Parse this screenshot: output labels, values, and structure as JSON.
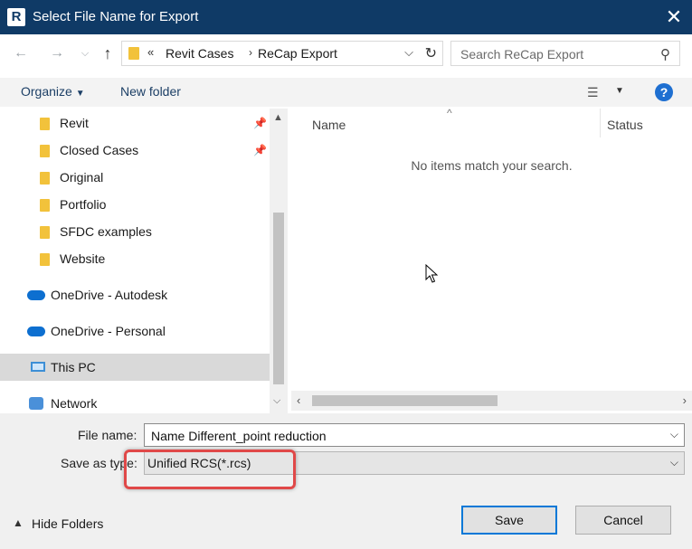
{
  "window": {
    "title": "Select File Name for Export",
    "app_icon_letter": "R"
  },
  "address_bar": {
    "overflow": "«",
    "crumbs": [
      "Revit Cases",
      "ReCap Export"
    ],
    "separator": "›"
  },
  "search": {
    "placeholder": "Search ReCap Export"
  },
  "toolbar": {
    "organize_label": "Organize",
    "new_folder_label": "New folder",
    "help_label": "?"
  },
  "nav_pane": {
    "quick_access": [
      {
        "label": "Revit",
        "pinned": true
      },
      {
        "label": "Closed Cases",
        "pinned": true
      },
      {
        "label": "Original",
        "pinned": false
      },
      {
        "label": "Portfolio",
        "pinned": false
      },
      {
        "label": "SFDC examples",
        "pinned": false
      },
      {
        "label": "Website",
        "pinned": false
      }
    ],
    "onedrive_autodesk": "OneDrive - Autodesk",
    "onedrive_personal": "OneDrive - Personal",
    "this_pc": "This PC",
    "network": "Network",
    "selected": "This PC"
  },
  "file_list": {
    "columns": [
      "Name",
      "Status"
    ],
    "empty_message": "No items match your search."
  },
  "bottom": {
    "file_name_label": "File name:",
    "file_name_value": "Name Different_point reduction",
    "save_type_label": "Save as type:",
    "save_type_value": "Unified RCS(*.rcs)",
    "hide_folders_label": "Hide Folders",
    "save_label": "Save",
    "cancel_label": "Cancel"
  },
  "colors": {
    "title_bar": "#0f3a66",
    "accent": "#0078d7",
    "highlight": "#e04848",
    "folder": "#f2c23b"
  }
}
